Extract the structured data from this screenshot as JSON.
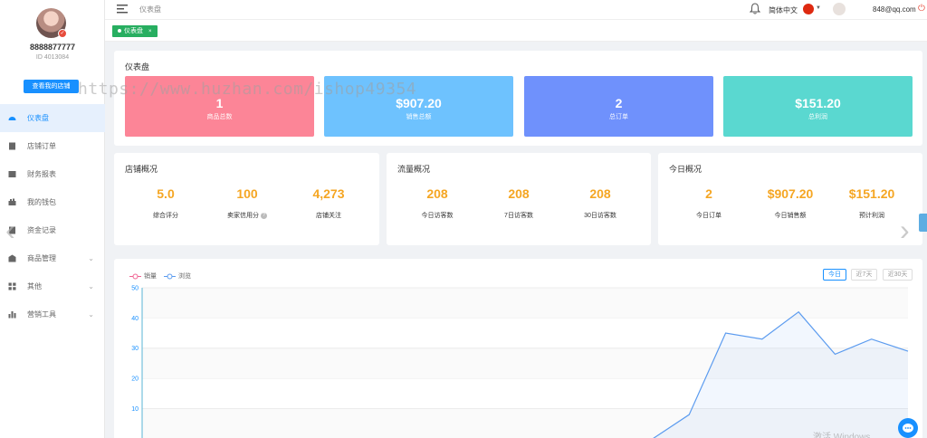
{
  "sidebar": {
    "phone": "8888877777",
    "user_id": "ID 4013084",
    "shop_button": "查看我的店铺",
    "items": [
      {
        "label": "仪表盘",
        "icon": "dashboard-icon",
        "active": true,
        "chevron": false
      },
      {
        "label": "店铺订单",
        "icon": "order-icon",
        "active": false,
        "chevron": false
      },
      {
        "label": "财务报表",
        "icon": "report-icon",
        "active": false,
        "chevron": false
      },
      {
        "label": "我的钱包",
        "icon": "wallet-icon",
        "active": false,
        "chevron": false
      },
      {
        "label": "资金记录",
        "icon": "record-icon",
        "active": false,
        "chevron": false
      },
      {
        "label": "商品管理",
        "icon": "goods-icon",
        "active": false,
        "chevron": true
      },
      {
        "label": "其他",
        "icon": "grid-icon",
        "active": false,
        "chevron": true
      },
      {
        "label": "营销工具",
        "icon": "bar-icon",
        "active": false,
        "chevron": true
      }
    ]
  },
  "topbar": {
    "breadcrumb": "仪表盘",
    "language": "简体中文",
    "email": "848@qq.com"
  },
  "tab": {
    "label": "仪表盘",
    "close": "×"
  },
  "dashboard": {
    "title": "仪表盘",
    "cards": [
      {
        "value": "1",
        "label": "商品总数",
        "color": "#fc8597"
      },
      {
        "value": "$907.20",
        "label": "销售总额",
        "color": "#6ec2fe"
      },
      {
        "value": "2",
        "label": "总订单",
        "color": "#6f91fc"
      },
      {
        "value": "$151.20",
        "label": "总利润",
        "color": "#5ad8d0"
      }
    ]
  },
  "store": {
    "title": "店铺概况",
    "metrics": [
      {
        "value": "5.0",
        "label": "综合评分"
      },
      {
        "value": "100",
        "label": "卖家信用分"
      },
      {
        "value": "4,273",
        "label": "店铺关注"
      }
    ]
  },
  "traffic": {
    "title": "流量概况",
    "metrics": [
      {
        "value": "208",
        "label": "今日访客数"
      },
      {
        "value": "208",
        "label": "7日访客数"
      },
      {
        "value": "208",
        "label": "30日访客数"
      }
    ]
  },
  "today": {
    "title": "今日概况",
    "metrics": [
      {
        "value": "2",
        "label": "今日订单"
      },
      {
        "value": "$907.20",
        "label": "今日销售额"
      },
      {
        "value": "$151.20",
        "label": "预计利润"
      }
    ]
  },
  "chart_controls": {
    "today": "今日",
    "days7": "近7天",
    "days30": "近30天"
  },
  "overlay": {
    "watermark": "https://www.huzhan.com/ishop49354",
    "os_watermark": "激活 Windows"
  },
  "chart_data": {
    "type": "line",
    "ylim": [
      0,
      50
    ],
    "yticks": [
      10,
      20,
      30,
      40,
      50
    ],
    "grid": true,
    "legend_position": "top-left",
    "series": [
      {
        "name": "销量",
        "color": "#f06292",
        "values": [
          0,
          0,
          0,
          0,
          0,
          0,
          0,
          0,
          0,
          0,
          0,
          0,
          0,
          0,
          0,
          0,
          0,
          0,
          0,
          0
        ]
      },
      {
        "name": "浏览",
        "color": "#5b9bef",
        "values": [
          0,
          0,
          0,
          0,
          0,
          0,
          0,
          0,
          0,
          0,
          0,
          0,
          0,
          0,
          0,
          8,
          35,
          33,
          42,
          28,
          33,
          29
        ]
      }
    ]
  },
  "colors": {
    "accent": "#1890ff",
    "metric": "#f5a623"
  }
}
